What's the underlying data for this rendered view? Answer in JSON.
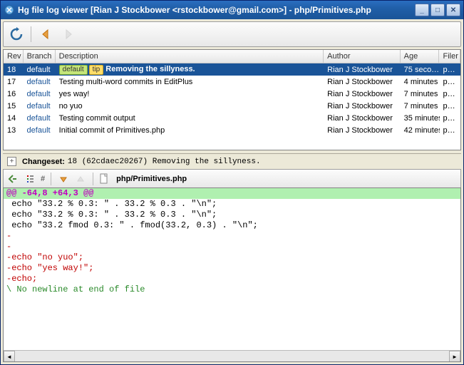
{
  "window": {
    "title": "Hg file log viewer [Rian J Stockbower <rstockbower@gmail.com>] - php/Primitives.php"
  },
  "table": {
    "headers": {
      "rev": "Rev",
      "branch": "Branch",
      "description": "Description",
      "author": "Author",
      "age": "Age",
      "filer": "Filer"
    },
    "rows": [
      {
        "rev": "18",
        "branch": "default",
        "has_tags": true,
        "tag1": "default",
        "tag2": "tip",
        "desc": "Removing the sillyness.",
        "author": "Rian J Stockbower",
        "age": "75 seco…",
        "filer": "p…",
        "selected": true
      },
      {
        "rev": "17",
        "branch": "default",
        "desc": "Testing multi-word commits in EditPlus",
        "author": "Rian J Stockbower",
        "age": "4 minutes",
        "filer": "p…"
      },
      {
        "rev": "16",
        "branch": "default",
        "desc": "yes way!",
        "author": "Rian J Stockbower",
        "age": "7 minutes",
        "filer": "p…"
      },
      {
        "rev": "15",
        "branch": "default",
        "desc": "no yuo",
        "author": "Rian J Stockbower",
        "age": "7 minutes",
        "filer": "p…"
      },
      {
        "rev": "14",
        "branch": "default",
        "desc": "Testing commit output",
        "author": "Rian J Stockbower",
        "age": "35 minutes",
        "filer": "p…"
      },
      {
        "rev": "13",
        "branch": "default",
        "desc": "Initial commit of Primitives.php",
        "author": "Rian J Stockbower",
        "age": "42 minutes",
        "filer": "p…"
      }
    ]
  },
  "changeset": {
    "label": "Changeset:",
    "text": "18 (62cdaec20267) Removing the sillyness."
  },
  "diff": {
    "path": "php/Primitives.php",
    "lines": [
      {
        "cls": "hunk-header",
        "text": "@@ -64,8 +64,3 @@"
      },
      {
        "cls": "ctx",
        "text": " echo \"33.2 % 0.3: \" . 33.2 % 0.3 . \"\\n\";"
      },
      {
        "cls": "ctx",
        "text": " echo \"33.2 % 0.3: \" . 33.2 % 0.3 . \"\\n\";"
      },
      {
        "cls": "ctx",
        "text": " echo \"33.2 fmod 0.3: \" . fmod(33.2, 0.3) . \"\\n\";"
      },
      {
        "cls": "del",
        "text": "-"
      },
      {
        "cls": "del",
        "text": "-"
      },
      {
        "cls": "del",
        "text": "-echo \"no yuo\";"
      },
      {
        "cls": "del",
        "text": "-echo \"yes way!\";"
      },
      {
        "cls": "del",
        "text": "-echo;"
      },
      {
        "cls": "noeol",
        "text": "\\ No newline at end of file"
      }
    ]
  }
}
